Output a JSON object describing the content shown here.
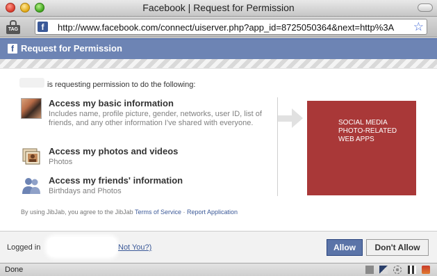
{
  "window": {
    "title": "Facebook | Request for Permission"
  },
  "browser": {
    "url": "http://www.facebook.com/connect/uiserver.php?app_id=8725050364&next=http%3A",
    "tag_label": "TAG",
    "status": "Done"
  },
  "dialog": {
    "header": "Request for Permission",
    "intro": "is requesting permission to do the following:",
    "permissions": [
      {
        "title": "Access my basic information",
        "description": "Includes name, profile picture, gender, networks, user ID, list of friends, and any other information I've shared with everyone."
      },
      {
        "title": "Access my photos and videos",
        "description": "Photos"
      },
      {
        "title": "Access my friends' information",
        "description": "Birthdays and Photos"
      }
    ],
    "overlay": {
      "line1": "SOCIAL MEDIA",
      "line2": "PHOTO-RELATED",
      "line3": "WEB APPS",
      "color": "#a93838"
    },
    "tos": {
      "prefix": "By using JibJab, you agree to the JibJab",
      "terms_link": "Terms of Service",
      "separator": "·",
      "report_link": "Report Application"
    },
    "footer": {
      "logged_in": "Logged in",
      "not_you": "Not You?)",
      "allow": "Allow",
      "deny": "Don't Allow"
    }
  },
  "colors": {
    "fb_blue": "#3b5998",
    "header_blue": "#6d84b4",
    "allow_blue": "#5b74a8"
  }
}
